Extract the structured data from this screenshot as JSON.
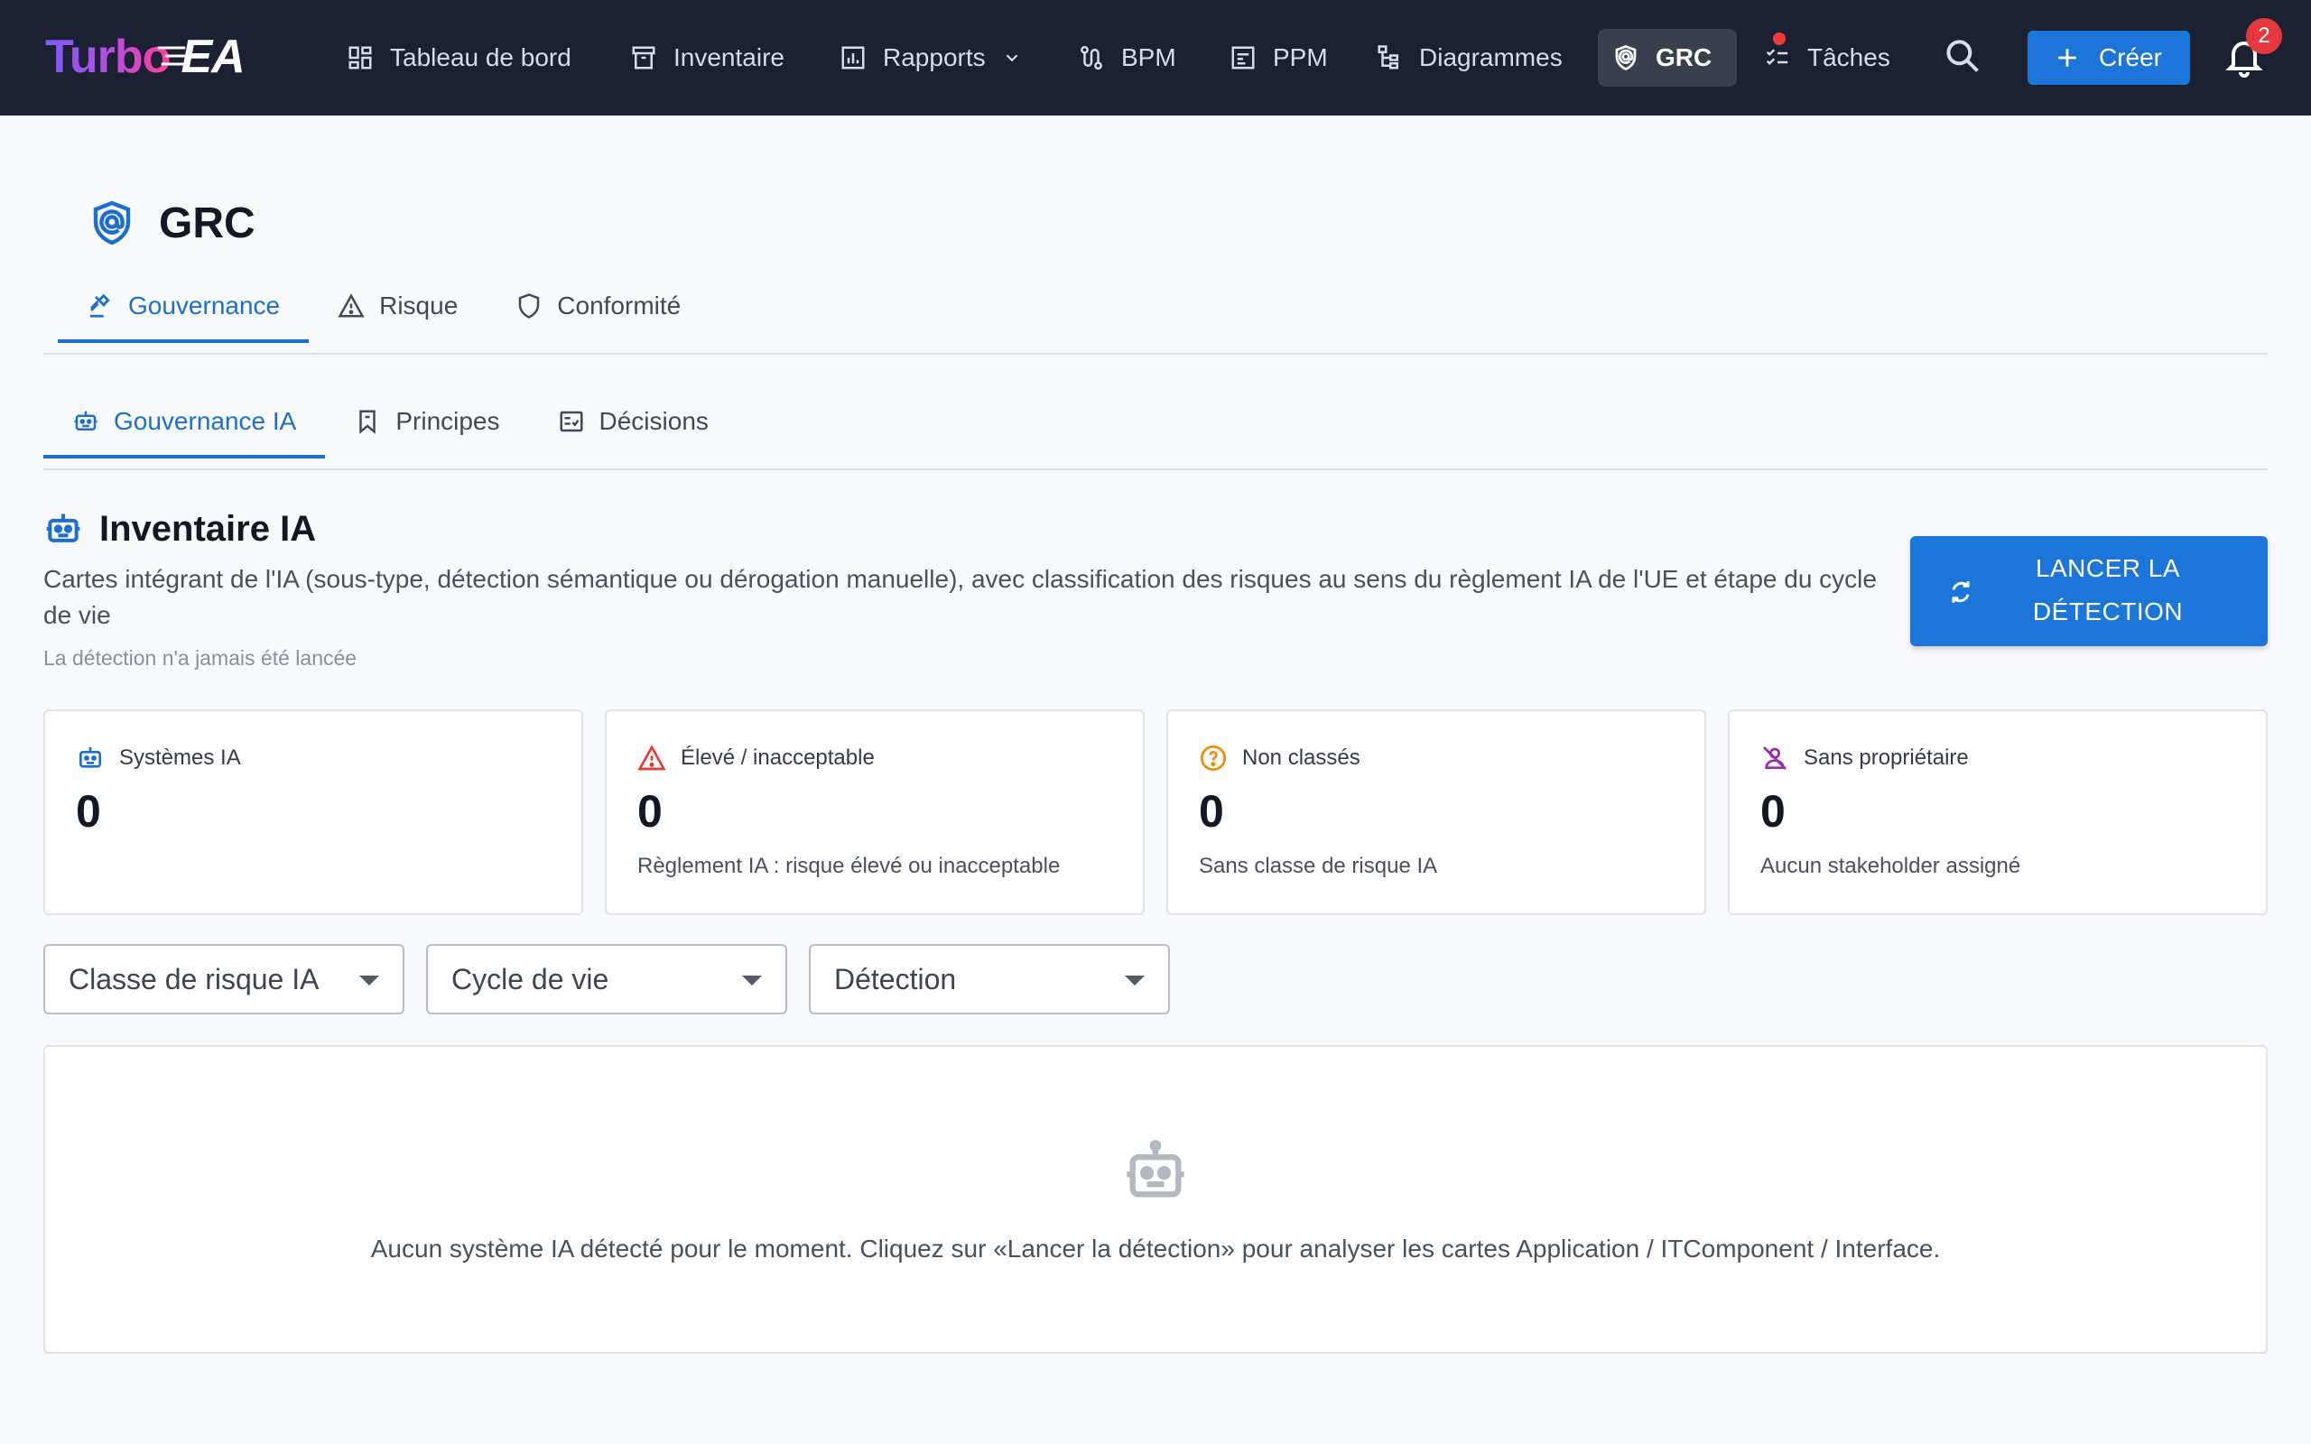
{
  "app": {
    "brand_part1": "Turbo",
    "brand_part2": "EA"
  },
  "nav": {
    "items": [
      {
        "label": "Tableau de bord",
        "icon": "dashboard-icon"
      },
      {
        "label": "Inventaire",
        "icon": "archive-icon"
      },
      {
        "label": "Rapports",
        "icon": "report-chart-icon"
      },
      {
        "label": "BPM",
        "icon": "process-route-icon"
      },
      {
        "label": "PPM",
        "icon": "portfolio-icon"
      },
      {
        "label": "Diagrammes",
        "icon": "diagram-tree-icon"
      },
      {
        "label": "GRC",
        "icon": "shield-icon",
        "active": true
      },
      {
        "label": "Tâches",
        "icon": "checklist-icon"
      }
    ],
    "create_label": "Créer",
    "notification_count": "2"
  },
  "page": {
    "title": "GRC",
    "main_tabs": [
      {
        "label": "Gouvernance",
        "icon": "gavel-icon",
        "active": true
      },
      {
        "label": "Risque",
        "icon": "warning-triangle-icon"
      },
      {
        "label": "Conformité",
        "icon": "shield-outline-icon"
      }
    ],
    "sub_tabs": [
      {
        "label": "Gouvernance IA",
        "icon": "robot-icon",
        "active": true
      },
      {
        "label": "Principes",
        "icon": "bookmark-icon"
      },
      {
        "label": "Décisions",
        "icon": "fact-check-icon"
      }
    ]
  },
  "section": {
    "title": "Inventaire IA",
    "description": "Cartes intégrant de l'IA (sous-type, détection sémantique ou dérogation manuelle), avec classification des risques au sens du règlement IA de l'UE et étape du cycle de vie",
    "note": "La détection n'a jamais été lancée",
    "detect_button_line1": "LANCER LA",
    "detect_button_line2": "DÉTECTION"
  },
  "cards": [
    {
      "label": "Systèmes IA",
      "value": "0",
      "sub": "",
      "icon": "robot-icon",
      "color": "#1c6fd0"
    },
    {
      "label": "Élevé / inacceptable",
      "value": "0",
      "sub": "Règlement IA : risque élevé ou inacceptable",
      "icon": "warning-triangle-icon",
      "color": "#e53935"
    },
    {
      "label": "Non classés",
      "value": "0",
      "sub": "Sans classe de risque IA",
      "icon": "help-circle-icon",
      "color": "#f08a00"
    },
    {
      "label": "Sans propriétaire",
      "value": "0",
      "sub": "Aucun stakeholder assigné",
      "icon": "person-off-icon",
      "color": "#9c27b0"
    }
  ],
  "filters": [
    {
      "label": "Classe de risque IA"
    },
    {
      "label": "Cycle de vie"
    },
    {
      "label": "Détection"
    }
  ],
  "empty_state": {
    "message": "Aucun système IA détecté pour le moment. Cliquez sur «Lancer la détection» pour analyser les cartes Application / ITComponent / Interface."
  },
  "colors": {
    "topbar_bg": "#1b2132",
    "accent": "#1c75d8",
    "badge": "#e5393e"
  }
}
